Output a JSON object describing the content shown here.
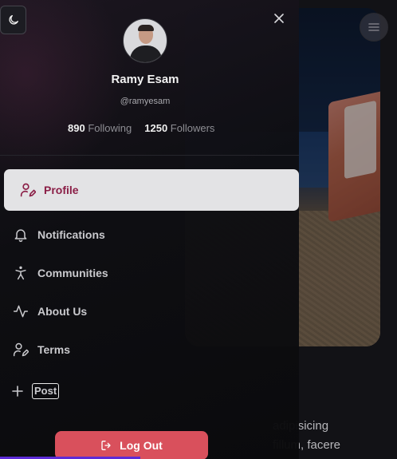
{
  "background": {
    "text_lines": [
      "adipisicing",
      "fillum, facere"
    ]
  },
  "drawer": {
    "profile": {
      "name": "Ramy Esam",
      "handle": "@ramyesam",
      "following_count": "890",
      "following_label": "Following",
      "followers_count": "1250",
      "followers_label": "Followers"
    },
    "nav": {
      "active": {
        "label": "Profile",
        "icon": "user-edit-icon"
      },
      "items": [
        {
          "label": "Notifications",
          "icon": "bell-icon"
        },
        {
          "label": "Communities",
          "icon": "accessibility-icon"
        },
        {
          "label": "About Us",
          "icon": "activity-icon"
        },
        {
          "label": "Terms",
          "icon": "user-edit-icon"
        }
      ]
    },
    "post_label": "Post",
    "logout_label": "Log Out"
  },
  "colors": {
    "accent_active_text": "#8b1f47",
    "logout_bg": "#d9505c",
    "bottom_bar": "#5d2bd6"
  }
}
